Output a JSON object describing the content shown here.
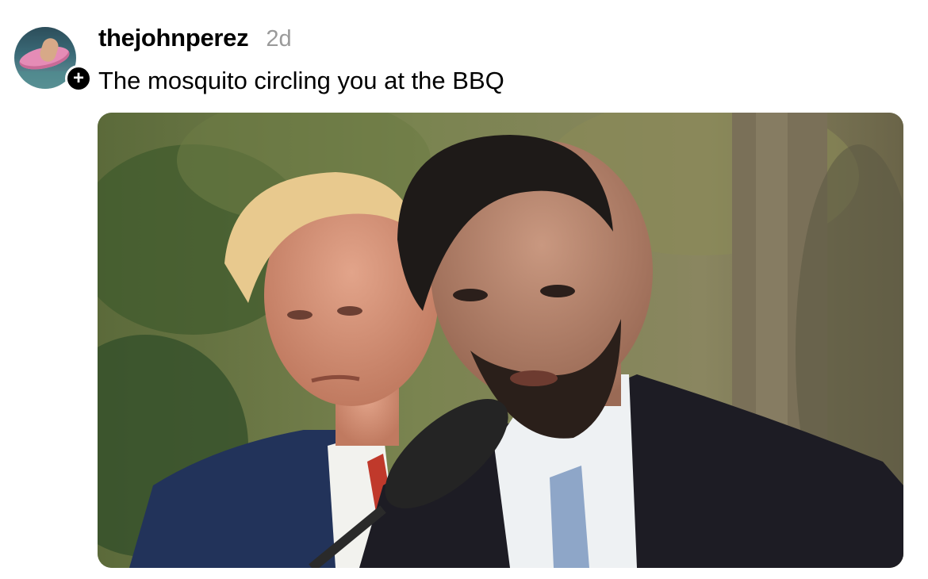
{
  "post": {
    "username": "thejohnperez",
    "timestamp": "2d",
    "text": "The mosquito circling you at the BBQ",
    "follow_symbol": "+"
  },
  "media": {
    "type": "photo"
  }
}
